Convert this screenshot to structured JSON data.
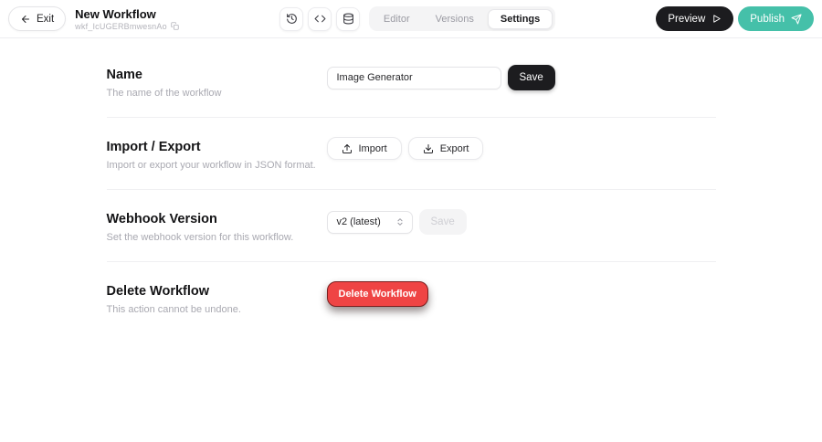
{
  "header": {
    "exit_label": "Exit",
    "title": "New Workflow",
    "workflow_id": "wkf_IcUGERBmwesnAo",
    "tabs": [
      {
        "label": "Editor",
        "active": false
      },
      {
        "label": "Versions",
        "active": false
      },
      {
        "label": "Settings",
        "active": true
      }
    ],
    "icon_buttons": [
      "history-icon",
      "code-icon",
      "database-icon"
    ],
    "preview_label": "Preview",
    "publish_label": "Publish"
  },
  "sections": {
    "name": {
      "title": "Name",
      "description": "The name of the workflow",
      "input_value": "Image Generator",
      "save_label": "Save"
    },
    "import_export": {
      "title": "Import / Export",
      "description": "Import or export your workflow in JSON format.",
      "import_label": "Import",
      "export_label": "Export"
    },
    "webhook": {
      "title": "Webhook Version",
      "description": "Set the webhook version for this workflow.",
      "selected_version": "v2 (latest)",
      "save_label": "Save",
      "save_disabled": true
    },
    "delete": {
      "title": "Delete Workflow",
      "description": "This action cannot be undone.",
      "button_label": "Delete Workflow"
    }
  },
  "colors": {
    "accent_teal": "#45c0a9",
    "danger_red": "#ef4444",
    "dark": "#1c1c1f"
  }
}
